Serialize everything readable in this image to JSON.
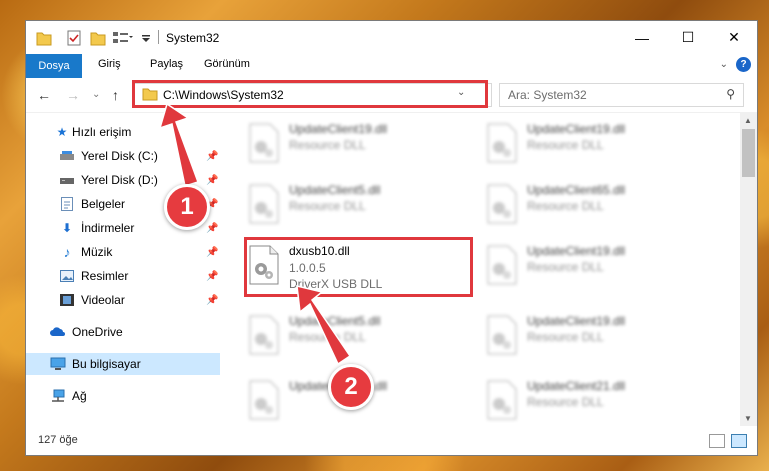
{
  "window": {
    "title": "System32",
    "controls": {
      "minimize": "—",
      "maximize": "☐",
      "close": "✕"
    }
  },
  "ribbon": {
    "tabs": [
      "Dosya",
      "Giriş",
      "Paylaş",
      "Görünüm"
    ],
    "help": "?"
  },
  "nav": {
    "back": "←",
    "forward": "→",
    "recent": "⌄",
    "up": "↑",
    "address": "C:\\Windows\\System32",
    "search_placeholder": "Ara: System32"
  },
  "sidebar": {
    "items": [
      {
        "label": "Hızlı erişim",
        "icon": "star-icon"
      },
      {
        "label": "Yerel Disk (C:)",
        "icon": "drive-icon",
        "pinned": true
      },
      {
        "label": "Yerel Disk (D:)",
        "icon": "drive-icon",
        "pinned": true
      },
      {
        "label": "Belgeler",
        "icon": "document-icon",
        "pinned": true
      },
      {
        "label": "İndirmeler",
        "icon": "download-icon",
        "pinned": true
      },
      {
        "label": "Müzik",
        "icon": "music-icon",
        "pinned": true
      },
      {
        "label": "Resimler",
        "icon": "pictures-icon",
        "pinned": true
      },
      {
        "label": "Videolar",
        "icon": "video-icon",
        "pinned": true
      },
      {
        "label": "OneDrive",
        "icon": "cloud-icon"
      },
      {
        "label": "Bu bilgisayar",
        "icon": "computer-icon",
        "selected": true
      },
      {
        "label": "Ağ",
        "icon": "network-icon"
      }
    ]
  },
  "files": {
    "left": [
      {
        "name": "UpdateClient19.dll",
        "desc": "Resource DLL"
      },
      {
        "name": "UpdateClient5.dll",
        "desc": "Resource DLL"
      },
      {
        "name": "dxusb10.dll",
        "version": "1.0.0.5",
        "desc": "DriverX USB DLL"
      },
      {
        "name": "UpdateClient5.dll",
        "desc": "Resource DLL"
      },
      {
        "name": "UpdateClient19.dll",
        "desc": ""
      }
    ],
    "right": [
      {
        "name": "UpdateClient19.dll",
        "desc": "Resource DLL"
      },
      {
        "name": "UpdateClient65.dll",
        "desc": "Resource DLL"
      },
      {
        "name": "UpdateClient19.dll",
        "desc": "Resource DLL"
      },
      {
        "name": "UpdateClient19.dll",
        "desc": "Resource DLL"
      },
      {
        "name": "UpdateClient21.dll",
        "desc": "Resource DLL"
      }
    ]
  },
  "status": {
    "item_count": "127 öğe"
  },
  "annotations": {
    "step1": "1",
    "step2": "2",
    "color": "#e0383d"
  }
}
